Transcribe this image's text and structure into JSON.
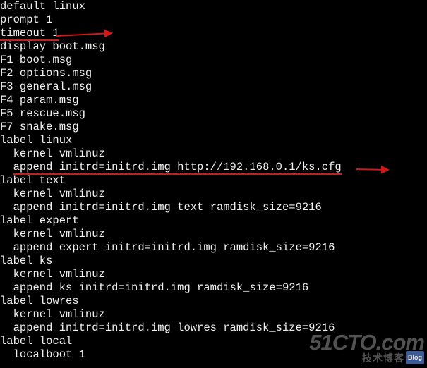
{
  "lines": [
    {
      "id": "l01",
      "text": "default linux"
    },
    {
      "id": "l02",
      "text": "prompt 1"
    },
    {
      "id": "l03",
      "text": "timeout 1",
      "underline": true
    },
    {
      "id": "l04",
      "text": "display boot.msg"
    },
    {
      "id": "l05",
      "text": "F1 boot.msg"
    },
    {
      "id": "l06",
      "text": "F2 options.msg"
    },
    {
      "id": "l07",
      "text": "F3 general.msg"
    },
    {
      "id": "l08",
      "text": "F4 param.msg"
    },
    {
      "id": "l09",
      "text": "F5 rescue.msg"
    },
    {
      "id": "l10",
      "text": "F7 snake.msg"
    },
    {
      "id": "l11",
      "text": "label linux"
    },
    {
      "id": "l12",
      "text": "  kernel vmlinuz"
    },
    {
      "id": "l13_a",
      "text": "  ",
      "plain": true
    },
    {
      "id": "l13_b",
      "text": "append initrd=initrd.img http://192.168.0.1/ks.cfg",
      "underline": true,
      "samerow": true
    },
    {
      "id": "l14",
      "text": "label text"
    },
    {
      "id": "l15",
      "text": "  kernel vmlinuz"
    },
    {
      "id": "l16",
      "text": "  append initrd=initrd.img text ramdisk_size=9216"
    },
    {
      "id": "l17",
      "text": "label expert"
    },
    {
      "id": "l18",
      "text": "  kernel vmlinuz"
    },
    {
      "id": "l19",
      "text": "  append expert initrd=initrd.img ramdisk_size=9216"
    },
    {
      "id": "l20",
      "text": "label ks"
    },
    {
      "id": "l21",
      "text": "  kernel vmlinuz"
    },
    {
      "id": "l22",
      "text": "  append ks initrd=initrd.img ramdisk_size=9216"
    },
    {
      "id": "l23",
      "text": "label lowres"
    },
    {
      "id": "l24",
      "text": "  kernel vmlinuz"
    },
    {
      "id": "l25",
      "text": "  append initrd=initrd.img lowres ramdisk_size=9216"
    },
    {
      "id": "l26",
      "text": "label local"
    },
    {
      "id": "l27",
      "text": "  localboot 1"
    }
  ],
  "watermark": {
    "big": "51CTO.com",
    "sub": "技术博客",
    "badge": "Blog"
  }
}
